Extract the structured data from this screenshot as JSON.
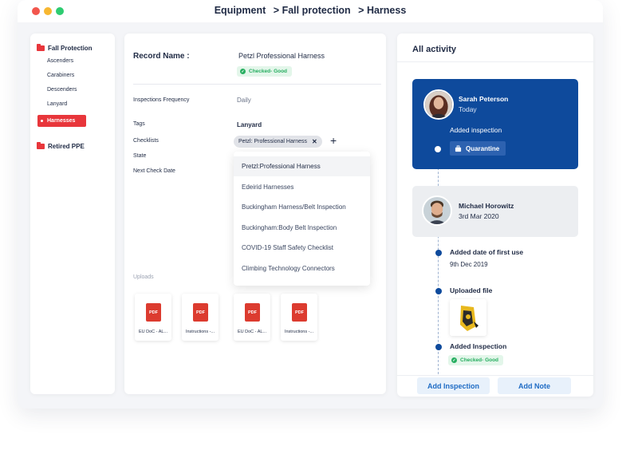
{
  "breadcrumb": [
    "Equipment",
    "> Fall protection",
    "> Harness"
  ],
  "sidebar": {
    "groups": [
      {
        "label": "Fall Protection",
        "items": [
          "Ascenders",
          "Carabiners",
          "Descenders",
          "Lanyard",
          "Harnesses"
        ],
        "active": "Harnesses"
      },
      {
        "label": "Retired PPE",
        "items": []
      }
    ]
  },
  "record": {
    "name_label": "Record Name :",
    "name_value": "Petzl Professional Harness",
    "status_badge": "Checked- Good",
    "inspection_frequency_label": "Inspections Frequency",
    "inspection_frequency_value": "Daily",
    "tags_label": "Tags",
    "tags_value": "Lanyard",
    "checklists_label": "Checklists",
    "checklist_chip": "Petzl: Professional Harness",
    "state_label": "State",
    "next_check_label": "Next Check Date",
    "uploads_label": "Uploads"
  },
  "checklist_dropdown": {
    "options": [
      "Pretzl:Professional Harness",
      "Edeirid Harnesses",
      "Buckingham Harness/Belt Inspection",
      "Buckingham:Body Belt Inspection",
      "COVID-19 Staff Safety Checklist",
      "Climbing Technology Connectors"
    ],
    "highlighted": "Pretzl:Professional Harness"
  },
  "uploads": [
    "EU DoC - AL...",
    "Instructions -...",
    "EU DoC - AL...",
    "Instructions -..."
  ],
  "pdf_label": "PDF",
  "activity": {
    "title": "All activity",
    "entries": [
      {
        "person": "Sarah Peterson",
        "date": "Today",
        "action": "Added inspection",
        "badge": "Quarantine"
      },
      {
        "person": "Michael Horowitz",
        "date": "3rd Mar 2020"
      }
    ],
    "timeline": [
      {
        "title": "Added date of first use",
        "subtitle": "9th Dec 2019"
      },
      {
        "title": "Uploaded file"
      },
      {
        "title": "Added Inspection",
        "badge": "Checked- Good"
      }
    ],
    "buttons": {
      "add_inspection": "Add Inspection",
      "add_note": "Add Note"
    }
  },
  "colors": {
    "accent_red": "#e8363b",
    "brand_blue": "#0e4a9c",
    "success_green": "#27ae60",
    "link_blue": "#1e6bc4"
  }
}
